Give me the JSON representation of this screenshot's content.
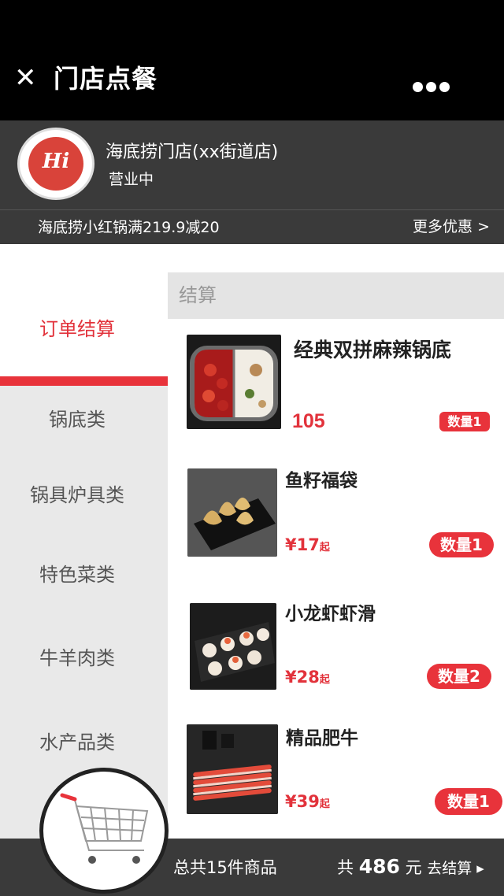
{
  "header": {
    "close_icon": "close-icon",
    "title": "门店点餐",
    "more_icon": "more-icon"
  },
  "store": {
    "logo_text": "Hi",
    "name": "海底捞门店(xx街道店)",
    "status": "营业中",
    "promo": "海底捞小红锅满219.9减20",
    "promo_more": "更多优惠 >"
  },
  "sidebar": {
    "active": "订单结算",
    "categories": [
      "锅底类",
      "锅具炉具类",
      "特色菜类",
      "牛羊肉类",
      "水产品类"
    ]
  },
  "section_title": "结算",
  "items": [
    {
      "name": "经典双拼麻辣锅底",
      "price": "105",
      "qty": "数量1"
    },
    {
      "name": "鱼籽福袋",
      "price": "¥17",
      "price_suffix": "起",
      "qty": "数量1"
    },
    {
      "name": "小龙虾虾滑",
      "price": "¥28",
      "price_suffix": "起",
      "qty": "数量2"
    },
    {
      "name": "精品肥牛",
      "price": "¥39",
      "price_suffix": "起",
      "qty": "数量1"
    }
  ],
  "footer": {
    "total_count": "总共15件商品",
    "total_prefix": "共",
    "total_value": "486",
    "total_unit": "元",
    "checkout_label": "去结算 ▸"
  },
  "colors": {
    "accent": "#e8333b",
    "dark": "#3a3a3a",
    "topbar": "#000000",
    "sidebar_bg": "#e9e9e9"
  }
}
